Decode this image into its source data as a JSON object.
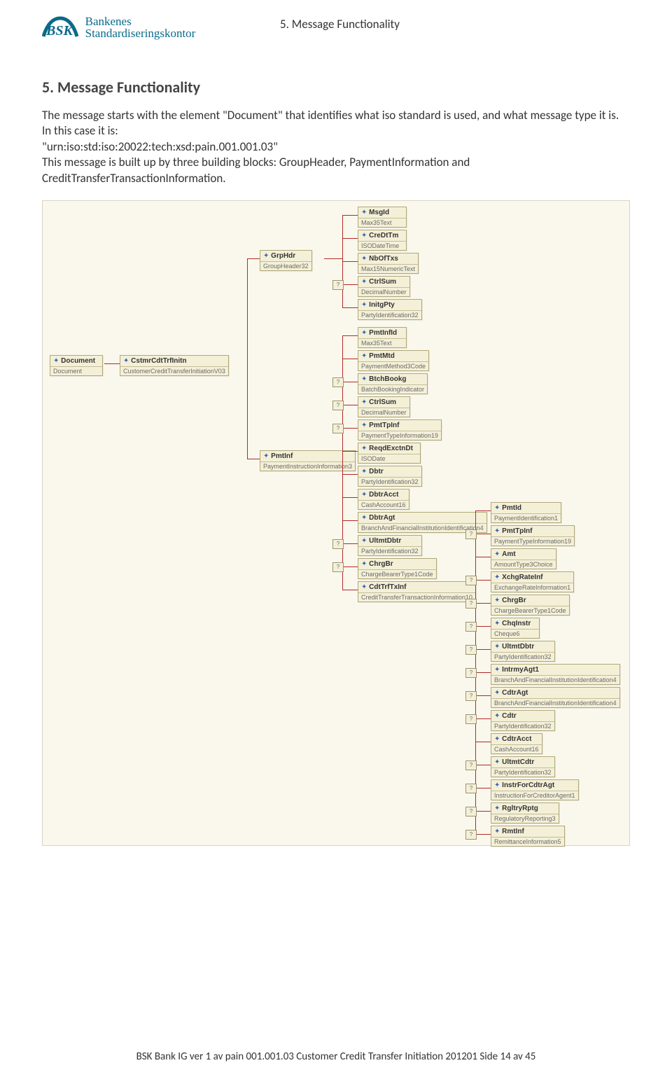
{
  "header": {
    "logo_line1": "Bankenes",
    "logo_line2": "Standardiseringskontor",
    "section_ref": "5. Message Functionality"
  },
  "section": {
    "heading": "5. Message Functionality",
    "para1": "The message starts with the element \"Document\" that identifies what iso standard is used, and what message type it is. In this case it is:",
    "para2": "\"urn:iso:std:iso:20022:tech:xsd:pain.001.001.03\"",
    "para3": "This message is built up by three building blocks: GroupHeader, PaymentInformation and CreditTransferTransactionInformation."
  },
  "diagram": {
    "root": [
      {
        "name": "Document",
        "type": "Document"
      },
      {
        "name": "CstmrCdtTrfInitn",
        "type": "CustomerCreditTransferInitiationV03"
      }
    ],
    "level2": [
      {
        "name": "GrpHdr",
        "type": "GroupHeader32"
      },
      {
        "name": "PmtInf",
        "type": "PaymentInstructionInformation3"
      }
    ],
    "grphdr": [
      {
        "name": "MsgId",
        "type": "Max35Text"
      },
      {
        "name": "CreDtTm",
        "type": "ISODateTime"
      },
      {
        "name": "NbOfTxs",
        "type": "Max15NumericText"
      },
      {
        "name": "CtrlSum",
        "type": "DecimalNumber"
      },
      {
        "name": "InitgPty",
        "type": "PartyIdentification32"
      }
    ],
    "pmtinf": [
      {
        "name": "PmtInfId",
        "type": "Max35Text"
      },
      {
        "name": "PmtMtd",
        "type": "PaymentMethod3Code"
      },
      {
        "name": "BtchBookg",
        "type": "BatchBookingIndicator"
      },
      {
        "name": "CtrlSum",
        "type": "DecimalNumber"
      },
      {
        "name": "PmtTpInf",
        "type": "PaymentTypeInformation19"
      },
      {
        "name": "ReqdExctnDt",
        "type": "ISODate"
      },
      {
        "name": "Dbtr",
        "type": "PartyIdentification32"
      },
      {
        "name": "DbtrAcct",
        "type": "CashAccount16"
      },
      {
        "name": "DbtrAgt",
        "type": "BranchAndFinancialInstitutionIdentification4"
      },
      {
        "name": "UltmtDbtr",
        "type": "PartyIdentification32"
      },
      {
        "name": "ChrgBr",
        "type": "ChargeBearerType1Code"
      },
      {
        "name": "CdtTrfTxInf",
        "type": "CreditTransferTransactionInformation10"
      }
    ],
    "cdttrf": [
      {
        "name": "PmtId",
        "type": "PaymentIdentification1"
      },
      {
        "name": "PmtTpInf",
        "type": "PaymentTypeInformation19"
      },
      {
        "name": "Amt",
        "type": "AmountType3Choice"
      },
      {
        "name": "XchgRateInf",
        "type": "ExchangeRateInformation1"
      },
      {
        "name": "ChrgBr",
        "type": "ChargeBearerType1Code"
      },
      {
        "name": "ChqInstr",
        "type": "Cheque6"
      },
      {
        "name": "UltmtDbtr",
        "type": "PartyIdentification32"
      },
      {
        "name": "IntrmyAgt1",
        "type": "BranchAndFinancialInstitutionIdentification4"
      },
      {
        "name": "CdtrAgt",
        "type": "BranchAndFinancialInstitutionIdentification4"
      },
      {
        "name": "Cdtr",
        "type": "PartyIdentification32"
      },
      {
        "name": "CdtrAcct",
        "type": "CashAccount16"
      },
      {
        "name": "UltmtCdtr",
        "type": "PartyIdentification32"
      },
      {
        "name": "InstrForCdtrAgt",
        "type": "InstructionForCreditorAgent1"
      },
      {
        "name": "RgltryRptg",
        "type": "RegulatoryReporting3"
      },
      {
        "name": "RmtInf",
        "type": "RemittanceInformation5"
      }
    ]
  },
  "footer": {
    "text": "BSK Bank IG ver 1 av pain 001.001.03 Customer Credit Transfer Initiation 201201   Side 14 av 45"
  }
}
